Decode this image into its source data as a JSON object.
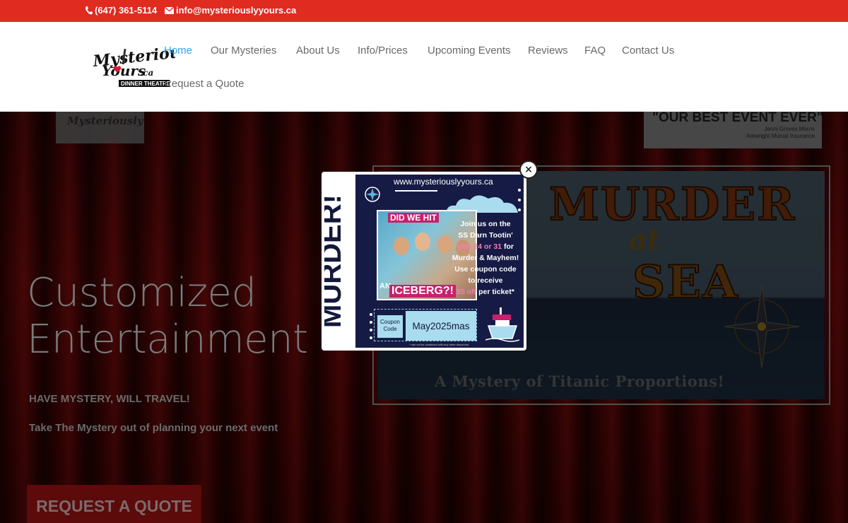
{
  "topbar": {
    "phone": "(647) 361-5114",
    "email": "info@mysteriouslyyours.ca",
    "bg_color": "#e02b20"
  },
  "logo": {
    "line1": "Mysteriously",
    "line2": "Yours",
    "suffix": ".ca",
    "badge": "DINNER THEATRE"
  },
  "nav": {
    "items": [
      {
        "label": "Home",
        "active": true
      },
      {
        "label": "Our Mysteries",
        "active": false
      },
      {
        "label": "About Us",
        "active": false
      },
      {
        "label": "Info/Prices",
        "active": false
      },
      {
        "label": "Upcoming Events",
        "active": false
      },
      {
        "label": "Reviews",
        "active": false
      },
      {
        "label": "FAQ",
        "active": false
      },
      {
        "label": "Contact Us",
        "active": false
      },
      {
        "label": "Request a Quote",
        "active": false
      }
    ],
    "active_color": "#2ea3f2"
  },
  "hero": {
    "headline_line1": "Customized",
    "headline_line2": "Entertainment",
    "tagline": "HAVE MYSTERY, WILL TRAVEL!",
    "subtag": "Take The Mystery out of planning your next event",
    "cta": "REQUEST A QUOTE",
    "testimonial": {
      "quote": "\"OUR BEST EVENT EVER\"",
      "name": "Jenni Groves Morris",
      "company": "Arkwright Mutual Insurance"
    }
  },
  "poster": {
    "title1": "MURDER",
    "title2": "at",
    "title3": "SEA",
    "subtitle": "A Mystery of Titanic Proportions!"
  },
  "popup": {
    "vertical_title": "MURDER!",
    "url": "www.mysteriouslyyours.ca",
    "photo_top": "DID WE HIT",
    "photo_an": "AN",
    "photo_bottom": "ICEBERG?!",
    "text_line1": "Join us on the",
    "text_line2": "SS Darn Tootin'",
    "text_line3_pink": "May 24 or 31",
    "text_line3_rest": " for",
    "text_line4": "Murder & Mayhem!",
    "text_line5": "Use coupon code",
    "text_line6": "to receive",
    "text_line7_pink": "$5 off",
    "text_line7_rest": " per ticket*",
    "coupon_label": "Coupon Code",
    "coupon_code": "May2025mas",
    "fine_print": "* can not be combined with any other discounts.",
    "close_label": "×"
  }
}
